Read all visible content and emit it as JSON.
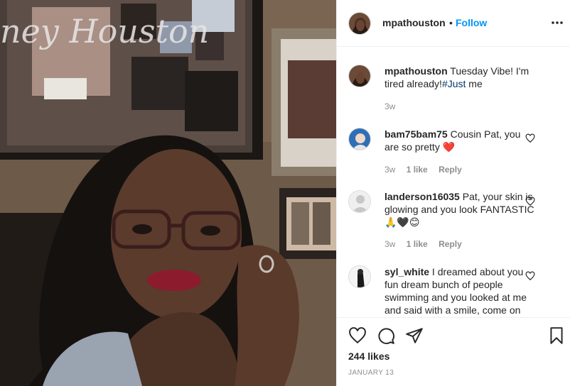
{
  "post": {
    "photo_signage": "ney Houston"
  },
  "header": {
    "username": "mpathouston",
    "separator": "•",
    "follow_label": "Follow",
    "more_icon": "more-horizontal-icon"
  },
  "caption": {
    "username": "mpathouston",
    "text": " Tuesday Vibe! I'm tired already!",
    "hashtag": "#Just",
    "text_after": " me",
    "time": "3w"
  },
  "comments": [
    {
      "username": "bam75bam75",
      "text": " Cousin Pat, you are so pretty ",
      "emoji": "❤️",
      "time": "3w",
      "likes": "1 like",
      "reply_label": "Reply"
    },
    {
      "username": "landerson16035",
      "text": " Pat, your skin is glowing and you look FANTASTIC ",
      "emoji": "🙏🖤😊",
      "time": "3w",
      "likes": "1 like",
      "reply_label": "Reply"
    },
    {
      "username": "syl_white",
      "text": " I dreamed about you fun dream bunch of people swimming and you looked at me and said with a smile, come on"
    }
  ],
  "footer": {
    "likes": "244 likes",
    "date": "JANUARY 13"
  },
  "colors": {
    "link": "#0095f6",
    "hashtag": "#00376b",
    "muted": "#8e8e8e",
    "heart": "#e2233a"
  }
}
